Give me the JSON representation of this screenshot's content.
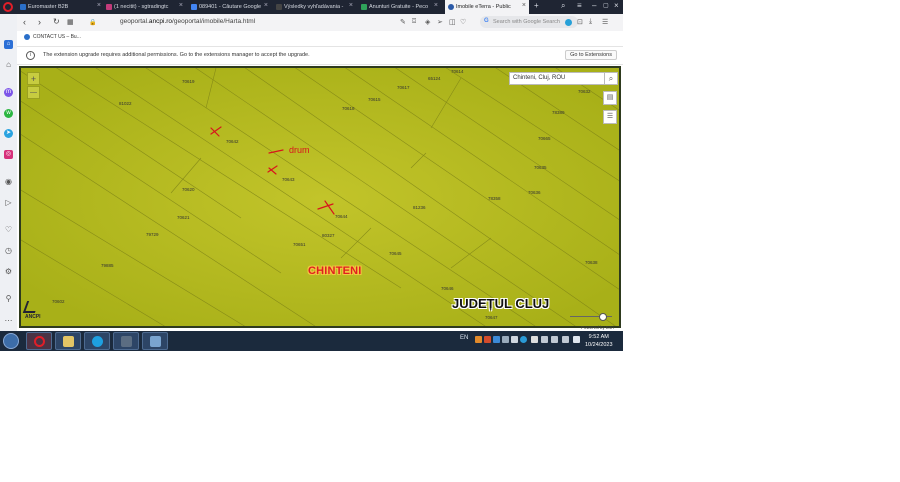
{
  "tabs": [
    {
      "label": "Euromaster B2B",
      "color": "#2a6fc9",
      "active": false
    },
    {
      "label": "(1 necitit) - sgtradingtc",
      "color": "#c23b7a",
      "active": false
    },
    {
      "label": "089401 - Căutare Google",
      "color": "#4285f4",
      "active": false
    },
    {
      "label": "Výsledky vyhľadávania -",
      "color": "#444444",
      "active": false
    },
    {
      "label": "Anunturi Gratuite - Peco",
      "color": "#2fa35a",
      "active": false
    },
    {
      "label": "Imobile eTerra - Public",
      "color": "#2b5aa8",
      "active": true
    }
  ],
  "address": {
    "url_prefix": "geoportal.",
    "url_domain": "ancpi.ro",
    "url_path": "/geoportal/imobile/Harta.html",
    "search_placeholder": "Search with Google Search"
  },
  "bookmarks": [
    {
      "label": "CONTACT US – Bu..."
    }
  ],
  "infobar": {
    "message": "The extension upgrade requires additional permissions. Go to the extensions manager to accept the upgrade.",
    "button": "Go to Extensions"
  },
  "map": {
    "search_value": "Chinteni, Cluj, ROU",
    "locality": "CHINTENI",
    "county": "JUDEȚUL CLUJ",
    "annotation": "drum",
    "logo_text": "ANCPI",
    "powered": "Powered by Esri",
    "zoom_in": "+",
    "zoom_out": "—",
    "parcels": [
      "70619",
      "81022",
      "70642",
      "70643",
      "70620",
      "70621",
      "79729",
      "79885",
      "70602",
      "70618",
      "70615",
      "70617",
      "65124",
      "70614",
      "70632",
      "78389",
      "70665",
      "70635",
      "70636",
      "78358",
      "81236",
      "70644",
      "80327",
      "70651",
      "70645",
      "70646",
      "70647",
      "70638"
    ]
  },
  "taskbar": {
    "lang": "EN",
    "time": "9:52 AM",
    "date": "10/24/2023"
  },
  "colors": {
    "map_fill": "#b5bb1a",
    "annotation": "#d8141c",
    "tab_bar": "#1f2533",
    "taskbar": "#1b2a3d"
  }
}
